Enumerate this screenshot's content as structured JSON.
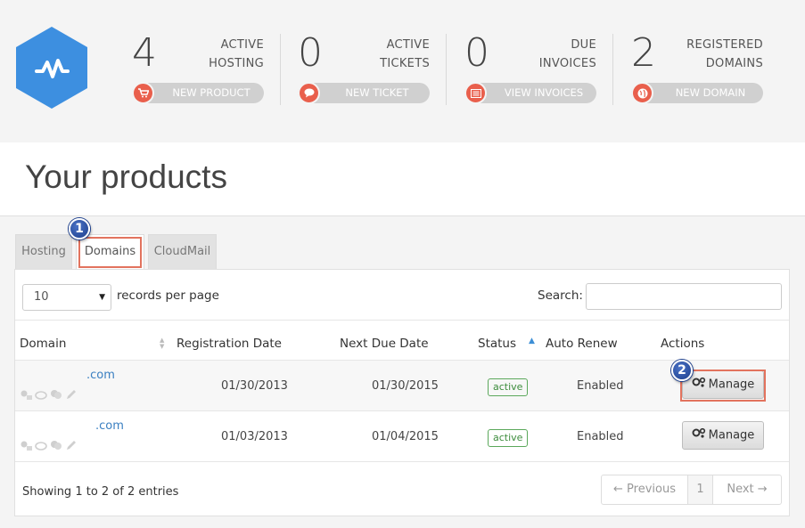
{
  "header": {
    "stats": [
      {
        "number": "4",
        "label_line1": "ACTIVE",
        "label_line2": "HOSTING",
        "button": "NEW PRODUCT",
        "icon": "cart-icon"
      },
      {
        "number": "0",
        "label_line1": "ACTIVE",
        "label_line2": "TICKETS",
        "button": "NEW TICKET",
        "icon": "speech-bubble-icon"
      },
      {
        "number": "0",
        "label_line1": "DUE",
        "label_line2": "INVOICES",
        "button": "VIEW INVOICES",
        "icon": "invoice-list-icon"
      },
      {
        "number": "2",
        "label_line1": "REGISTERED",
        "label_line2": "DOMAINS",
        "button": "NEW DOMAIN",
        "icon": "globe-icon"
      }
    ]
  },
  "page_title": "Your products",
  "tabs": [
    {
      "label": "Hosting",
      "active": false
    },
    {
      "label": "Domains",
      "active": true
    },
    {
      "label": "CloudMail",
      "active": false
    }
  ],
  "markers": [
    "1",
    "2"
  ],
  "table_controls": {
    "page_size": "10",
    "records_per_page": "records per page",
    "search_label": "Search:"
  },
  "table": {
    "columns": [
      "Domain",
      "Registration Date",
      "Next Due Date",
      "Status",
      "Auto Renew",
      "Actions"
    ],
    "rows": [
      {
        "domain": ".com",
        "registration_date": "01/30/2013",
        "next_due_date": "01/30/2015",
        "status": "active",
        "auto_renew": "Enabled",
        "action": "Manage"
      },
      {
        "domain": ".com",
        "registration_date": "01/03/2013",
        "next_due_date": "01/04/2015",
        "status": "active",
        "auto_renew": "Enabled",
        "action": "Manage"
      }
    ]
  },
  "footer": {
    "showing": "Showing 1 to 2 of 2 entries",
    "prev": "← Previous",
    "page": "1",
    "next": "Next →"
  },
  "colors": {
    "logo_blue": "#3d8fe0",
    "accent_red": "#e95f4c",
    "status_green": "#3c8c3c",
    "link_blue": "#3a7fc1",
    "marker_blue": "#1d3f8c"
  }
}
